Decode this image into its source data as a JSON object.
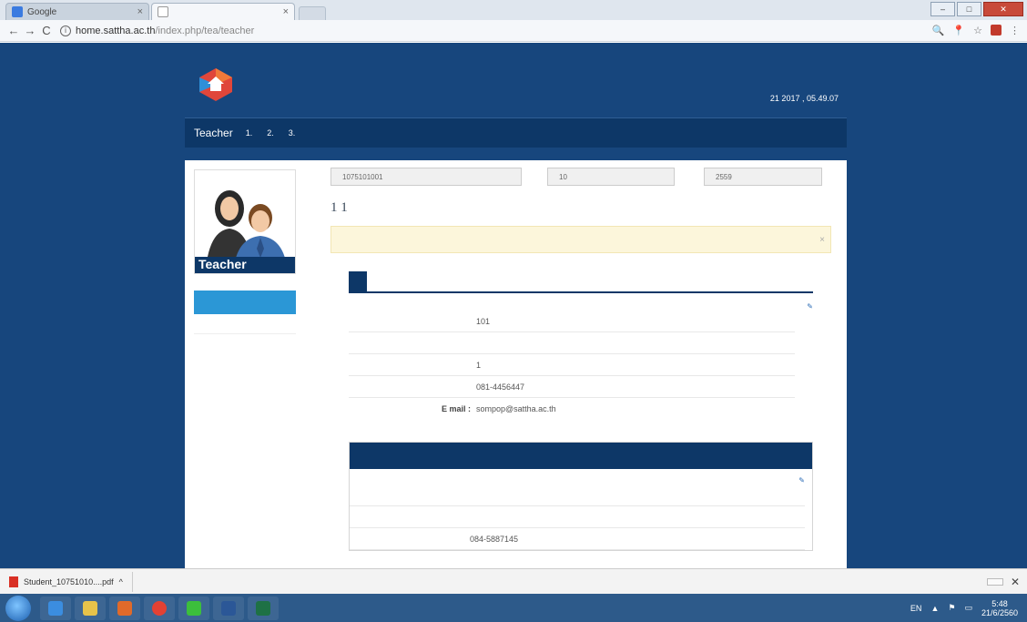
{
  "browser": {
    "tabs": [
      {
        "title": "Google",
        "active": false
      },
      {
        "title": "",
        "active": true
      }
    ],
    "url_host": "home.sattha.ac.th",
    "url_path": "/index.php/tea/teacher"
  },
  "header": {
    "title": "",
    "subtitle": "",
    "date": "21 2017 , 05.49.07",
    "accent": "#f3d24a"
  },
  "navbar": {
    "brand": "Teacher",
    "items": [
      "1.",
      "2.",
      "3."
    ],
    "logout": ""
  },
  "sidebar": {
    "avatar_label": "Teacher",
    "menu_head": "",
    "menu_items": [
      ""
    ]
  },
  "filters": [
    {
      "label": "",
      "value": "1075101001"
    },
    {
      "label": "",
      "value": "10"
    },
    {
      "label": "",
      "value": "2559"
    }
  ],
  "main": {
    "heading": "1 1",
    "alert": "",
    "tabs": [
      "",
      ""
    ],
    "edit": "",
    "fields": [
      {
        "label": "",
        "value": "101"
      },
      {
        "label": "",
        "value": ""
      },
      {
        "label": "",
        "value": "1"
      },
      {
        "label": "",
        "value": "081-4456447"
      },
      {
        "label": "E mail :",
        "value": "sompop@sattha.ac.th"
      }
    ]
  },
  "co_advisor": {
    "title": "",
    "edit": "",
    "fields": [
      {
        "label": "",
        "value": ""
      },
      {
        "label": "",
        "value": ""
      },
      {
        "label": "",
        "value": "084-5887145"
      }
    ]
  },
  "download": {
    "file": "Student_10751010....pdf",
    "show_all": ""
  },
  "taskbar": {
    "lang": "EN",
    "time": "5:48",
    "date": "21/6/2560"
  }
}
